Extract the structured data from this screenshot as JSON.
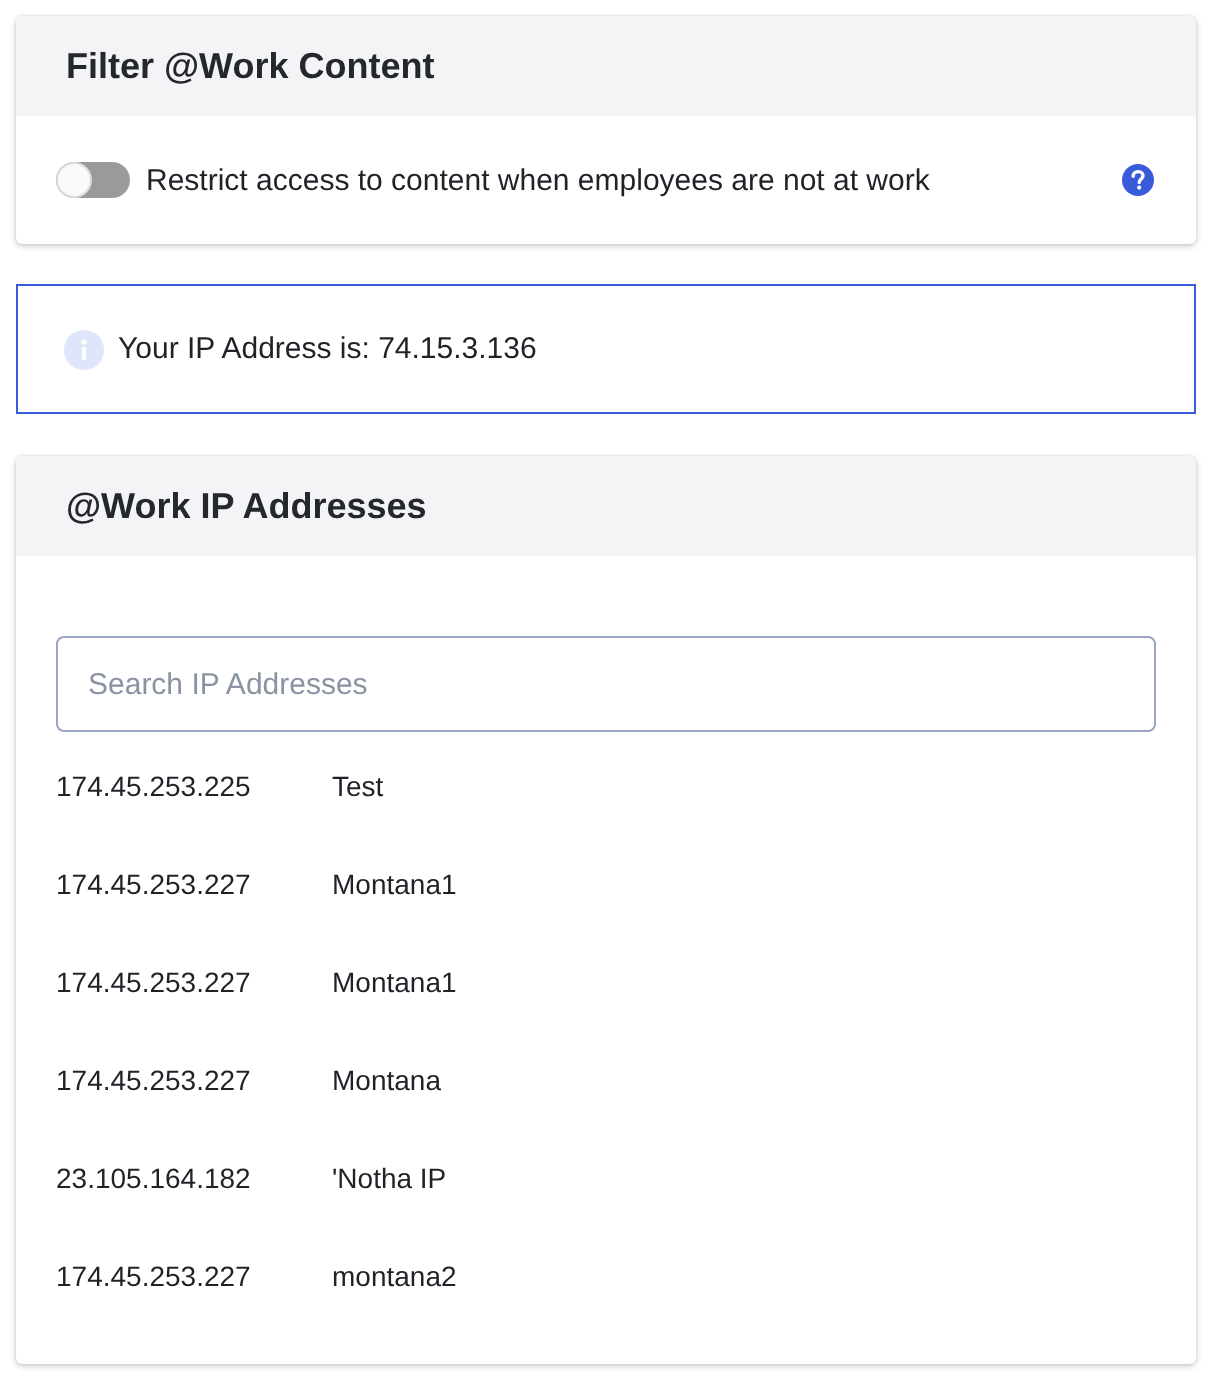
{
  "filter_card": {
    "title": "Filter @Work Content",
    "toggle": {
      "label": "Restrict access to content when employees are not at work",
      "on": false
    }
  },
  "ip_notice": {
    "text": "Your IP Address is: 74.15.3.136"
  },
  "ip_card": {
    "title": "@Work IP Addresses",
    "search": {
      "placeholder": "Search IP Addresses"
    },
    "rows": [
      {
        "address": "174.45.253.225",
        "name": "Test"
      },
      {
        "address": "174.45.253.227",
        "name": "Montana1"
      },
      {
        "address": "174.45.253.227",
        "name": "Montana1"
      },
      {
        "address": "174.45.253.227",
        "name": "Montana"
      },
      {
        "address": "23.105.164.182",
        "name": "'Notha IP"
      },
      {
        "address": "174.45.253.227",
        "name": "montana2"
      }
    ]
  }
}
